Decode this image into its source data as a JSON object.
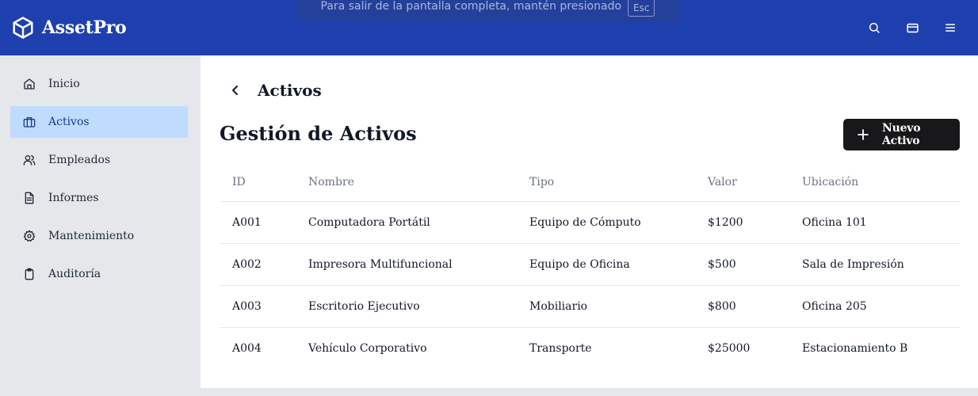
{
  "app": {
    "name": "AssetPro"
  },
  "fullscreen_notice": {
    "text": "Para salir de la pantalla completa, mantén presionado",
    "key": "Esc"
  },
  "sidebar": {
    "items": [
      {
        "label": "Inicio",
        "icon": "home-icon",
        "active": false
      },
      {
        "label": "Activos",
        "icon": "briefcase-icon",
        "active": true
      },
      {
        "label": "Empleados",
        "icon": "users-icon",
        "active": false
      },
      {
        "label": "Informes",
        "icon": "file-text-icon",
        "active": false
      },
      {
        "label": "Mantenimiento",
        "icon": "gear-icon",
        "active": false
      },
      {
        "label": "Auditoría",
        "icon": "clipboard-icon",
        "active": false
      }
    ]
  },
  "breadcrumb": {
    "title": "Activos"
  },
  "page": {
    "title": "Gestión de Activos",
    "new_button": "Nuevo Activo"
  },
  "table": {
    "headers": [
      "ID",
      "Nombre",
      "Tipo",
      "Valor",
      "Ubicación"
    ],
    "rows": [
      [
        "A001",
        "Computadora Portátil",
        "Equipo de Cómputo",
        "$1200",
        "Oficina 101"
      ],
      [
        "A002",
        "Impresora Multifuncional",
        "Equipo de Oficina",
        "$500",
        "Sala de Impresión"
      ],
      [
        "A003",
        "Escritorio Ejecutivo",
        "Mobiliario",
        "$800",
        "Oficina 205"
      ],
      [
        "A004",
        "Vehículo Corporativo",
        "Transporte",
        "$25000",
        "Estacionamiento B"
      ]
    ]
  },
  "colors": {
    "topbar": "#1e40af",
    "active_nav": "#bfdbfe",
    "primary_button": "#18181b"
  }
}
